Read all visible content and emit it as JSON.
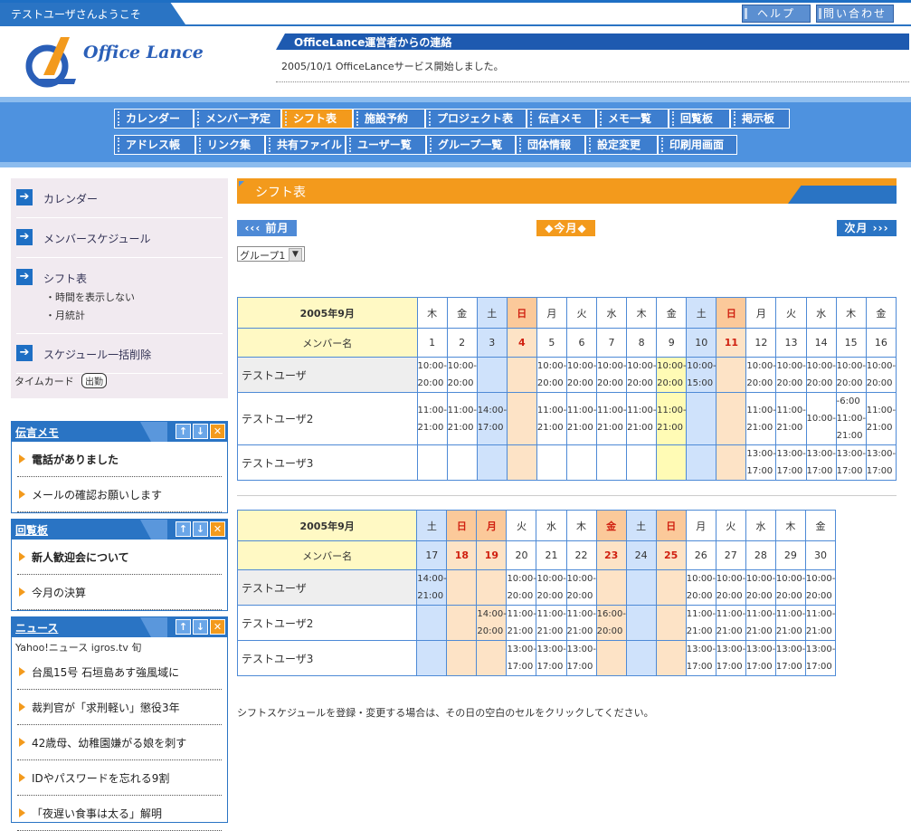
{
  "header": {
    "welcome": "テストユーザさんようこそ",
    "help": "ヘルプ",
    "contact": "問い合わせ",
    "logo": "Office Lance",
    "notice_title": "OfficeLance運営者からの連絡",
    "notice_body": "2005/10/1 OfficeLanceサービス開始しました。"
  },
  "menu": {
    "row1": [
      "カレンダー",
      "メンバー予定",
      "シフト表",
      "施設予約",
      "プロジェクト表",
      "伝言メモ",
      "メモ一覧",
      "回覧板",
      "掲示板"
    ],
    "row2": [
      "アドレス帳",
      "リンク集",
      "共有ファイル",
      "ユーザー覧",
      "グループ一覧",
      "団体情報",
      "設定変更",
      "印刷用画面"
    ],
    "active": "シフト表"
  },
  "sidenav": {
    "calendar": "カレンダー",
    "member_schedule": "メンバースケジュール",
    "shift": "シフト表",
    "hide_time": "・時間を表示しない",
    "monthly": "・月統計",
    "bulk_delete": "スケジュール一括削除",
    "timecard": "タイムカード",
    "clock_in": "出勤"
  },
  "memo": {
    "title": "伝言メモ",
    "items": [
      "電話がありました",
      "メールの確認お願いします"
    ]
  },
  "circular": {
    "title": "回覧板",
    "items": [
      "新人歓迎会について",
      "今月の決算"
    ]
  },
  "news": {
    "title": "ニュース",
    "source": "Yahoo!ニュース igros.tv 旬",
    "items": [
      "台風15号 石垣島あす強風域に",
      "裁判官が「求刑軽い」懲役3年",
      "42歳母、幼稚園嫌がる娘を刺す",
      "IDやパスワードを忘れる9割",
      "「夜遅い食事は太る」解明"
    ]
  },
  "main": {
    "title": "シフト表",
    "prev": "前月",
    "today": "今月",
    "next": "次月",
    "group": "グループ1",
    "footnote": "シフトスケジュールを登録・変更する場合は、その日の空白のセルをクリックしてください。",
    "month_label": "2005年9月",
    "member_label": "メンバー名"
  },
  "table1": {
    "weekdays": [
      "木",
      "金",
      "土",
      "日",
      "月",
      "火",
      "水",
      "木",
      "金",
      "土",
      "日",
      "月",
      "火",
      "水",
      "木",
      "金"
    ],
    "days": [
      "1",
      "2",
      "3",
      "4",
      "5",
      "6",
      "7",
      "8",
      "9",
      "10",
      "11",
      "12",
      "13",
      "14",
      "15",
      "16"
    ],
    "types": [
      "wk",
      "wk",
      "sat",
      "sunh",
      "wk",
      "wk",
      "wk",
      "wk",
      "tdy",
      "sat",
      "sunh",
      "wk",
      "wk",
      "wk",
      "wk",
      "wk"
    ],
    "rows": [
      {
        "name": "テストユーザ",
        "me": true,
        "cells": [
          "10:00-\n20:00",
          "10:00-\n20:00",
          "",
          "",
          "10:00-\n20:00",
          "10:00-\n20:00",
          "10:00-\n20:00",
          "10:00-\n20:00",
          "10:00-\n20:00",
          "10:00-\n15:00",
          "",
          "10:00-\n20:00",
          "10:00-\n20:00",
          "10:00-\n20:00",
          "10:00-\n20:00",
          "10:00-\n20:00"
        ]
      },
      {
        "name": "テストユーザ2",
        "me": false,
        "cells": [
          "11:00-\n21:00",
          "11:00-\n21:00",
          "14:00-\n17:00",
          "",
          "11:00-\n21:00",
          "11:00-\n21:00",
          "11:00-\n21:00",
          "11:00-\n21:00",
          "11:00-\n21:00",
          "",
          "",
          "11:00-\n21:00",
          "11:00-\n21:00",
          "10:00-",
          "-6:00\n11:00-\n21:00",
          "11:00-\n21:00"
        ]
      },
      {
        "name": "テストユーザ3",
        "me": false,
        "cells": [
          "",
          "",
          "",
          "",
          "",
          "",
          "",
          "",
          "",
          "",
          "",
          "13:00-\n17:00",
          "13:00-\n17:00",
          "13:00-\n17:00",
          "13:00-\n17:00",
          "13:00-\n17:00"
        ]
      }
    ]
  },
  "table2": {
    "weekdays": [
      "土",
      "日",
      "月",
      "火",
      "水",
      "木",
      "金",
      "土",
      "日",
      "月",
      "火",
      "水",
      "木",
      "金"
    ],
    "days": [
      "17",
      "18",
      "19",
      "20",
      "21",
      "22",
      "23",
      "24",
      "25",
      "26",
      "27",
      "28",
      "29",
      "30"
    ],
    "types": [
      "sat",
      "sunh",
      "sunh",
      "wk",
      "wk",
      "wk",
      "sunh",
      "sat",
      "sunh",
      "wk",
      "wk",
      "wk",
      "wk",
      "wk"
    ],
    "rows": [
      {
        "name": "テストユーザ",
        "me": true,
        "cells": [
          "14:00-\n21:00",
          "",
          "",
          "10:00-\n20:00",
          "10:00-\n20:00",
          "10:00-\n20:00",
          "",
          "",
          "",
          "10:00-\n20:00",
          "10:00-\n20:00",
          "10:00-\n20:00",
          "10:00-\n20:00",
          "10:00-\n20:00"
        ]
      },
      {
        "name": "テストユーザ2",
        "me": false,
        "cells": [
          "",
          "",
          "14:00-\n20:00",
          "11:00-\n21:00",
          "11:00-\n21:00",
          "11:00-\n21:00",
          "16:00-\n20:00",
          "",
          "",
          "11:00-\n21:00",
          "11:00-\n21:00",
          "11:00-\n21:00",
          "11:00-\n21:00",
          "11:00-\n21:00"
        ]
      },
      {
        "name": "テストユーザ3",
        "me": false,
        "cells": [
          "",
          "",
          "",
          "13:00-\n17:00",
          "13:00-\n17:00",
          "13:00-\n17:00",
          "",
          "",
          "",
          "13:00-\n17:00",
          "13:00-\n17:00",
          "13:00-\n17:00",
          "13:00-\n17:00",
          "13:00-\n17:00"
        ]
      }
    ]
  }
}
